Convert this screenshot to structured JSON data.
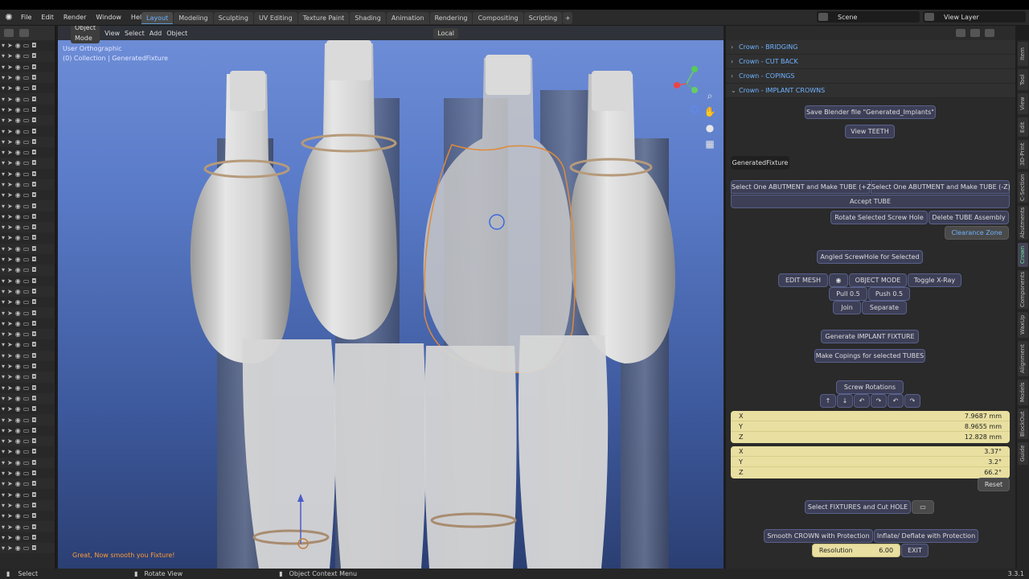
{
  "menu": [
    "File",
    "Edit",
    "Render",
    "Window",
    "Help"
  ],
  "workspaces": [
    {
      "label": "Layout",
      "active": true
    },
    {
      "label": "Modeling"
    },
    {
      "label": "Sculpting"
    },
    {
      "label": "UV Editing"
    },
    {
      "label": "Texture Paint"
    },
    {
      "label": "Shading"
    },
    {
      "label": "Animation"
    },
    {
      "label": "Rendering"
    },
    {
      "label": "Compositing"
    },
    {
      "label": "Scripting"
    }
  ],
  "scene": "Scene",
  "view_layer": "View Layer",
  "viewport": {
    "mode": "Object Mode",
    "menus": [
      "View",
      "Select",
      "Add",
      "Object"
    ],
    "orientation": "Local",
    "view_name": "User Orthographic",
    "collection": "(0) Collection | GeneratedFixture",
    "message": "Great, Now smooth you Fixture!"
  },
  "panel": {
    "sections": [
      "Crown - BRIDGING",
      "Crown - CUT BACK",
      "Crown - COPINGS",
      "Crown - IMPLANT CROWNS"
    ],
    "save_btn": "Save Blender file \"Generated_Implants\"",
    "view_teeth": "View TEETH",
    "active_object": "GeneratedFixture",
    "select_pz": "Select One ABUTMENT and Make TUBE (+Z)",
    "select_nz": "Select One ABUTMENT and Make TUBE (-Z)",
    "accept_tube": "Accept TUBE",
    "rotate_hole": "Rotate Selected Screw Hole",
    "delete_tube": "Delete TUBE Assembly",
    "clearance": "Clearance Zone",
    "angled": "Angled ScrewHole for Selected",
    "edit_mesh": "EDIT MESH",
    "object_mode": "OBJECT MODE",
    "xray": "Toggle X-Ray",
    "pull": "Pull 0.5",
    "push": "Push 0.5",
    "join": "Join",
    "separate": "Separate",
    "generate": "Generate IMPLANT FIXTURE",
    "copings": "Make Copings for selected TUBES",
    "screw_rot": "Screw Rotations",
    "location": [
      {
        "axis": "X",
        "value": "7.9687 mm"
      },
      {
        "axis": "Y",
        "value": "8.9655 mm"
      },
      {
        "axis": "Z",
        "value": "12.828 mm"
      }
    ],
    "rotation": [
      {
        "axis": "X",
        "value": "3.37°"
      },
      {
        "axis": "Y",
        "value": "3.2°"
      },
      {
        "axis": "Z",
        "value": "66.2°"
      }
    ],
    "reset": "Reset",
    "cut_hole": "Select FIXTURES and Cut HOLE",
    "smooth": "Smooth CROWN with Protection",
    "inflate": "Inflate/ Deflate with Protection",
    "resolution_label": "Resolution",
    "resolution_value": "6.00",
    "exit": "EXIT"
  },
  "side_tabs": [
    "Item",
    "Tool",
    "View",
    "Edit",
    "3D-Print",
    "C-Section",
    "Abutments",
    "Crown",
    "Components",
    "WaxUp",
    "Alignment",
    "Models",
    "BlockOut",
    "Guide"
  ],
  "status": {
    "select": "Select",
    "rotate": "Rotate View",
    "context": "Object Context Menu",
    "version": "3.3.1"
  }
}
